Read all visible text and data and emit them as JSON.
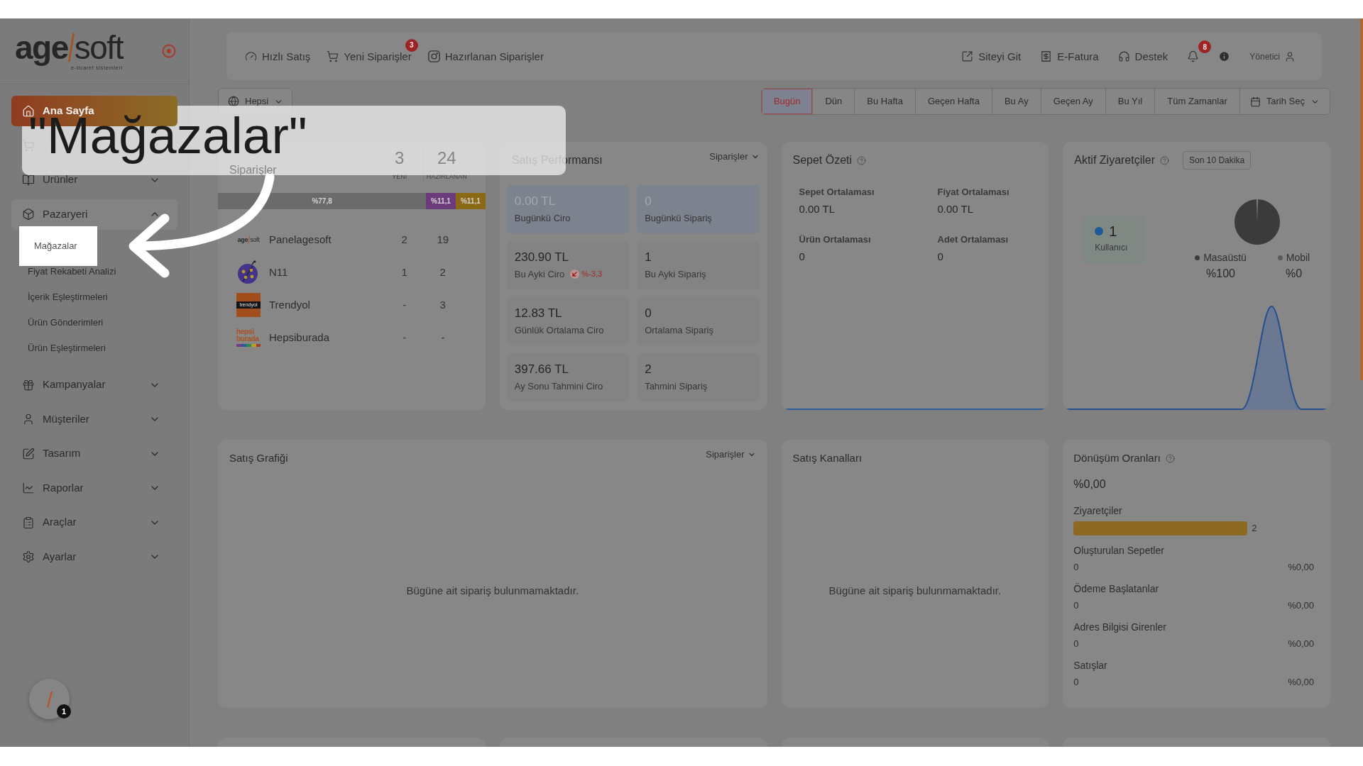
{
  "logo": {
    "wordmark": [
      "age",
      "soft"
    ],
    "tagline": "e-ticaret sistemleri"
  },
  "sidebar": {
    "items": [
      {
        "label": "Ana Sayfa",
        "kind": "link",
        "selected": true
      },
      {
        "kind": "group",
        "selected": false,
        "expanded": false
      },
      {
        "label": "Ürünler",
        "kind": "group",
        "selected": false,
        "expanded": false
      },
      {
        "label": "Pazaryeri",
        "kind": "group",
        "selected": false,
        "expanded": true,
        "children": [
          {
            "label": "Mağazalar",
            "spotlight": true
          },
          {
            "label": "Fiyat Rekabeti Analizi",
            "spotlight": false
          },
          {
            "label": "İçerik Eşleştirmeleri",
            "spotlight": false
          },
          {
            "label": "Ürün Gönderimleri",
            "spotlight": false
          },
          {
            "label": "Ürün Eşleştirmeleri",
            "spotlight": false
          }
        ]
      },
      {
        "label": "Kampanyalar",
        "kind": "group",
        "selected": false,
        "expanded": false
      },
      {
        "label": "Müşteriler",
        "kind": "group",
        "selected": false,
        "expanded": false
      },
      {
        "label": "Tasarım",
        "kind": "group",
        "selected": false,
        "expanded": false
      },
      {
        "label": "Raporlar",
        "kind": "group",
        "selected": false,
        "expanded": false
      },
      {
        "label": "Araçlar",
        "kind": "group",
        "selected": false,
        "expanded": false
      },
      {
        "label": "Ayarlar",
        "kind": "group",
        "selected": false,
        "expanded": false
      }
    ]
  },
  "launcher": {
    "badge": "1"
  },
  "header": {
    "left_links": [
      {
        "label": "Hızlı Satış"
      },
      {
        "label": "Yeni Siparişler",
        "badge": "3"
      },
      {
        "label": "Hazırlanan Siparişler"
      }
    ],
    "right_links": [
      {
        "label": "Siteyi Git"
      },
      {
        "label": "E-Fatura"
      },
      {
        "label": "Destek"
      }
    ],
    "notifications": {
      "badge": "8"
    },
    "user": {
      "label": "Yönetici"
    }
  },
  "filters": {
    "store": {
      "value": "Hepsi"
    },
    "date_ranges": [
      {
        "label": "Bugün",
        "selected": true
      },
      {
        "label": "Dün",
        "selected": false
      },
      {
        "label": "Bu Hafta",
        "selected": false
      },
      {
        "label": "Geçen Hafta",
        "selected": false
      },
      {
        "label": "Bu Ay",
        "selected": false
      },
      {
        "label": "Geçen Ay",
        "selected": false
      },
      {
        "label": "Bu Yıl",
        "selected": false
      },
      {
        "label": "Tüm Zamanlar",
        "selected": false
      }
    ],
    "date_picker": {
      "label": "Tarih Seç"
    }
  },
  "orders": {
    "title": "Siparişler",
    "counts": [
      {
        "value": "3",
        "label": "YENİ"
      },
      {
        "value": "24",
        "label": "HAZIRLANAN"
      }
    ],
    "share_chart": {
      "chart_data": {
        "type": "bar",
        "orientation": "horizontal",
        "stacked": true,
        "series": [
          {
            "color": "#6b6b6b",
            "values": [
              77.8
            ],
            "value_labels": [
              "%77,8"
            ]
          },
          {
            "color": "#6c3b7c",
            "values": [
              11.1
            ],
            "value_labels": [
              "%11,1"
            ]
          },
          {
            "color": "#8c6914",
            "values": [
              11.1
            ],
            "value_labels": [
              "%11,1"
            ]
          }
        ]
      }
    },
    "stores": [
      {
        "name": "Panelagesoft",
        "new": "2",
        "preparing": "19",
        "kind": "wordmark",
        "logo_text": [
          "age",
          "soft"
        ]
      },
      {
        "name": "N11",
        "new": "1",
        "preparing": "2",
        "kind": "ladybug"
      },
      {
        "name": "Trendyol",
        "new": "-",
        "preparing": "3",
        "kind": "band",
        "logo_text": [
          "trendyol"
        ]
      },
      {
        "name": "Hepsiburada",
        "new": "-",
        "preparing": "-",
        "kind": "stacked",
        "logo_text": [
          "hepsi",
          "burada"
        ]
      }
    ]
  },
  "performance": {
    "title": "Satış Performansı",
    "metric_menu": "Siparişler",
    "tiles": [
      {
        "value": "0.00 TL",
        "label": "Bugünkü Ciro",
        "highlight": true
      },
      {
        "value": "0",
        "label": "Bugünkü Sipariş",
        "highlight": true
      },
      {
        "value": "230.90 TL",
        "label": "Bu Ayki Ciro",
        "highlight": false,
        "change": {
          "text": "%-3,3",
          "negative": true
        }
      },
      {
        "value": "1",
        "label": "Bu Ayki Sipariş",
        "highlight": false
      },
      {
        "value": "12.83 TL",
        "label": "Günlük Ortalama Ciro",
        "highlight": false
      },
      {
        "value": "0",
        "label": "Ortalama Sipariş",
        "highlight": false
      },
      {
        "value": "397.66 TL",
        "label": "Ay Sonu Tahmini Ciro",
        "highlight": false
      },
      {
        "value": "2",
        "label": "Tahmini Sipariş",
        "highlight": false
      }
    ]
  },
  "basket": {
    "title": "Sepet Özeti",
    "stats": [
      {
        "label": "Sepet Ortalaması",
        "value": "0.00 TL"
      },
      {
        "label": "Fiyat Ortalaması",
        "value": "0.00 TL"
      },
      {
        "label": "Ürün Ortalaması",
        "value": "0"
      },
      {
        "label": "Adet Ortalaması",
        "value": "0"
      }
    ]
  },
  "visitors": {
    "title": "Aktif Ziyaretçiler",
    "period": "Son 10 Dakika",
    "active": {
      "count": "1",
      "label": "Kullanıcı"
    },
    "devices": {
      "chart_data": {
        "type": "pie",
        "categories": [
          "Masaüstü",
          "Mobil"
        ],
        "values": [
          100,
          0
        ],
        "value_labels": [
          "%100",
          "%0"
        ]
      }
    }
  },
  "sales_chart": {
    "title": "Satış Grafiği",
    "metric_menu": "Siparişler",
    "empty_text": "Bügüne ait sipariş bulunmamaktadır."
  },
  "channels": {
    "title": "Satış Kanalları",
    "empty_text": "Bügüne ait sipariş bulunmamaktadır."
  },
  "conversion": {
    "title": "Dönüşüm Oranları",
    "rate": "%0,00",
    "steps": [
      {
        "kind": "bar",
        "label": "Ziyaretçiler",
        "count": "2",
        "level": 1
      },
      {
        "kind": "ratio",
        "label": "Oluşturulan Sepetler",
        "count": "0",
        "percent": "%0,00"
      },
      {
        "kind": "ratio",
        "label": "Ödeme Başlatanlar",
        "count": "0",
        "percent": "%0,00"
      },
      {
        "kind": "ratio",
        "label": "Adres Bilgisi Girenler",
        "count": "0",
        "percent": "%0,00"
      },
      {
        "kind": "ratio",
        "label": "Satışlar",
        "count": "0",
        "percent": "%0,00"
      }
    ]
  },
  "callout": {
    "text": "\"Mağazalar\""
  }
}
